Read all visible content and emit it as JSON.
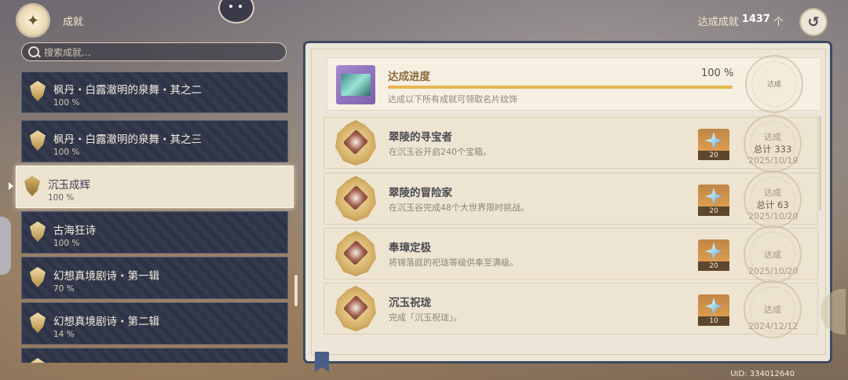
{
  "header": {
    "title": "成就",
    "total_label": "达成成就",
    "total_count": "1437",
    "total_unit": "个"
  },
  "search": {
    "placeholder": "搜索成就…"
  },
  "categories": [
    {
      "name": "枫丹・白露澈明的泉舞・其之二",
      "percent": "100 %"
    },
    {
      "name": "枫丹・白露澈明的泉舞・其之三",
      "percent": "100 %"
    },
    {
      "name": "沉玉成辉",
      "percent": "100 %"
    },
    {
      "name": "古海狂诗",
      "percent": "100 %"
    },
    {
      "name": "幻想真境剧诗・第一辑",
      "percent": "70 %"
    },
    {
      "name": "幻想真境剧诗・第二辑",
      "percent": "14 %"
    }
  ],
  "progress": {
    "title": "达成进度",
    "percent": "100 %",
    "fill": 1.0,
    "description": "达成以下所有成就可领取名片纹饰",
    "seal": "达成"
  },
  "achievements": [
    {
      "name": "翠陵的寻宝者",
      "description": "在沉玉谷开启240个宝箱。",
      "reward": "20",
      "status": "达成",
      "total": "总计 333",
      "date": "2025/10/19"
    },
    {
      "name": "翠陵的冒险家",
      "description": "在沉玉谷完成48个大世界限时挑战。",
      "reward": "20",
      "status": "达成",
      "total": "总计 63",
      "date": "2025/10/20"
    },
    {
      "name": "奉璋定极",
      "description": "将锦落庭的祀珑等级供奉至满级。",
      "reward": "20",
      "status": "达成",
      "total": "",
      "date": "2025/10/20"
    },
    {
      "name": "沉玉祝珑",
      "description": "完成「沉玉祝珑」。",
      "reward": "10",
      "status": "达成",
      "total": "",
      "date": "2024/12/12"
    }
  ],
  "uid": "UID: 334012640",
  "icons": {
    "emblem": "achievement-emblem-icon",
    "back": "back-arrow-icon",
    "search": "search-icon",
    "reward": "primogem-icon"
  }
}
